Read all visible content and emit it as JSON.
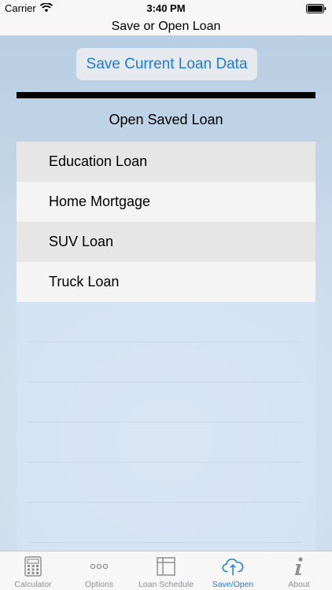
{
  "status_bar": {
    "carrier": "Carrier",
    "time": "3:40 PM"
  },
  "nav": {
    "title": "Save or Open Loan"
  },
  "main": {
    "save_button_label": "Save Current Loan Data",
    "section_title": "Open Saved Loan",
    "saved_loans": [
      "Education Loan",
      "Home Mortgage",
      "SUV Loan",
      "Truck Loan"
    ]
  },
  "tab_bar": {
    "tabs": [
      {
        "label": "Calculator",
        "icon": "calculator-icon"
      },
      {
        "label": "Options",
        "icon": "ellipsis-icon"
      },
      {
        "label": "Loan Schedule",
        "icon": "table-icon"
      },
      {
        "label": "Save/Open",
        "icon": "cloud-upload-icon",
        "active": true
      },
      {
        "label": "About",
        "icon": "info-icon"
      }
    ]
  },
  "colors": {
    "accent": "#1a7cea",
    "inactive": "#8e8e93"
  }
}
